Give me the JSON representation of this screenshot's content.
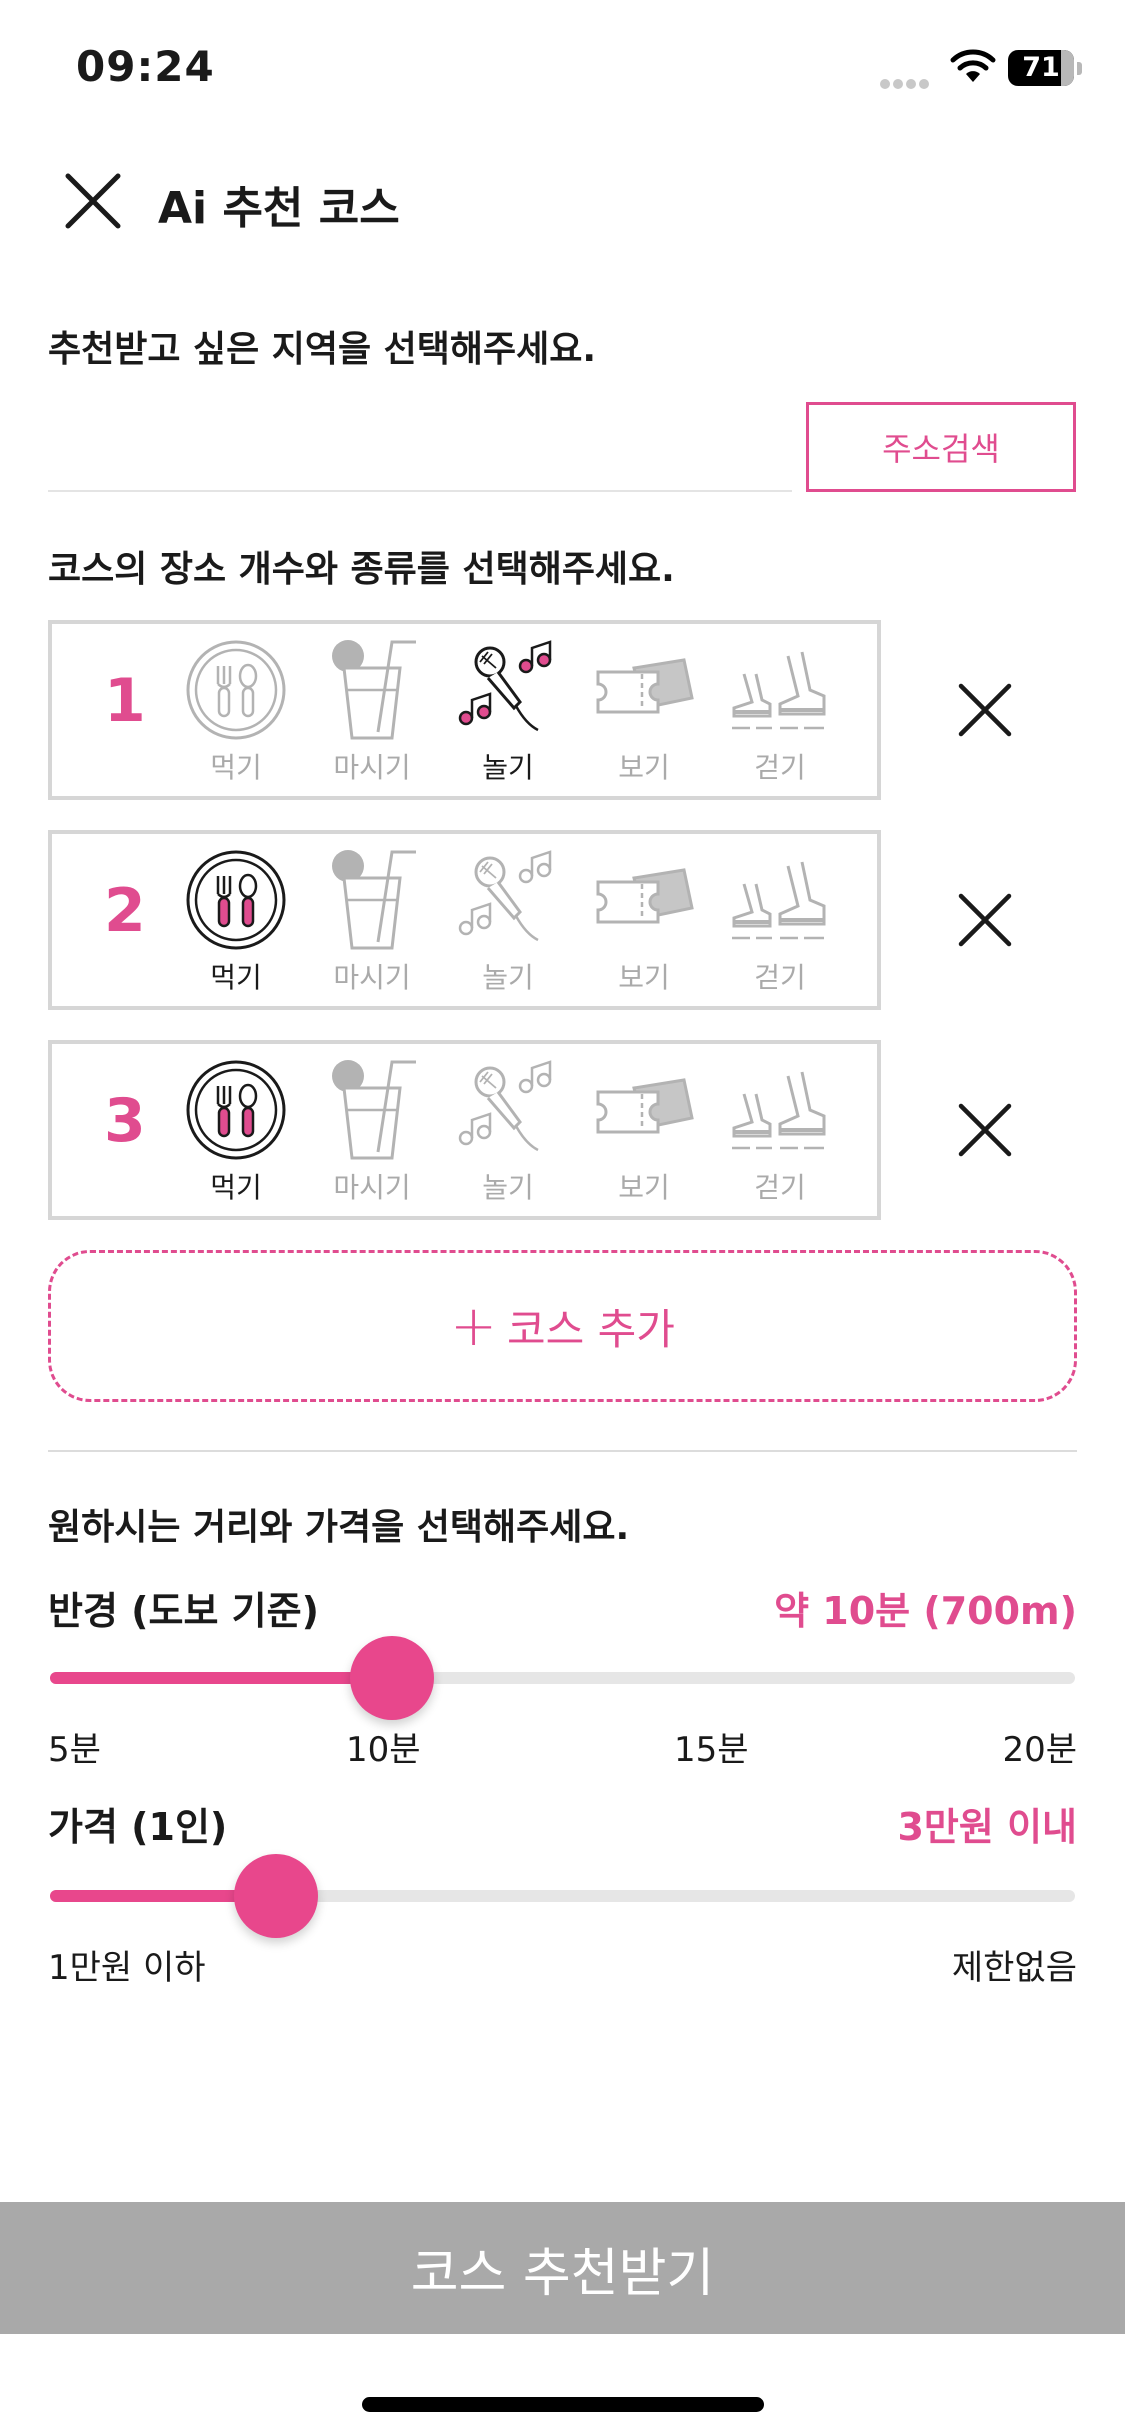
{
  "status_bar": {
    "time": "09:24",
    "battery": "71"
  },
  "nav": {
    "title": "Ai 추천 코스",
    "close_icon": "close-icon"
  },
  "region": {
    "label": "추천받고 싶은 지역을 선택해주세요.",
    "address_value": "",
    "search_button": "주소검색"
  },
  "courses": {
    "label": "코스의 장소 개수와 종류를 선택해주세요.",
    "categories": [
      {
        "label": "먹기",
        "icon": "plate-utensils-icon"
      },
      {
        "label": "마시기",
        "icon": "drink-icon"
      },
      {
        "label": "놀기",
        "icon": "microphone-music-icon"
      },
      {
        "label": "보기",
        "icon": "ticket-icon"
      },
      {
        "label": "걷기",
        "icon": "sneakers-icon"
      }
    ],
    "rows": [
      {
        "number": "1",
        "selected": "놀기"
      },
      {
        "number": "2",
        "selected": "먹기"
      },
      {
        "number": "3",
        "selected": "먹기"
      }
    ],
    "add_label": "코스 추가"
  },
  "preferences": {
    "label": "원하시는 거리와 가격을 선택해주세요.",
    "radius": {
      "label": "반경 (도보 기준)",
      "value_text": "약 10분 (700m)",
      "ticks": [
        "5분",
        "10분",
        "15분",
        "20분"
      ],
      "value": 10,
      "min": 5,
      "max": 20
    },
    "price": {
      "label": "가격 (1인)",
      "value_text": "3만원 이내",
      "min_label": "1만원 이하",
      "max_label": "제한없음",
      "position": 0.22
    }
  },
  "submit_label": "코스 추천받기",
  "colors": {
    "accent": "#e04c8f",
    "slider": "#e8478c",
    "inactive": "#aaaaaa",
    "submit_bg": "#a9a9a9"
  }
}
